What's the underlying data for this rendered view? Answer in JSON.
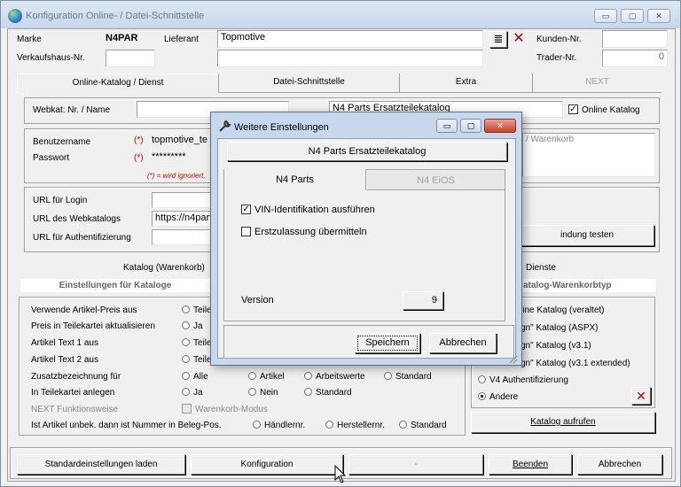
{
  "window": {
    "title": "Konfiguration Online- / Datei-Schnittstelle",
    "caption_buttons": {
      "minimize": "▭",
      "maximize": "▢",
      "close": "✕"
    }
  },
  "header": {
    "marke_label": "Marke",
    "marke_value": "N4PAR",
    "lieferant_label": "Lieferant",
    "lieferant_value": "Topmotive",
    "list_icon": "≣",
    "delete_icon": "✕",
    "kunden_nr_label": "Kunden-Nr.",
    "kunden_nr_value": "",
    "verkaufshaus_label": "Verkaufshaus-Nr.",
    "verkaufshaus_value": "",
    "trader_label": "Trader-Nr.",
    "trader_value": "0"
  },
  "tabs": [
    {
      "label": "Online-Katalog / Dienst"
    },
    {
      "label": "Datei-Schnittstelle"
    },
    {
      "label": "Extra"
    },
    {
      "label": "NEXT"
    }
  ],
  "online": {
    "webkat_label": "Webkat: Nr. / Name",
    "webkat_nr": "",
    "webkat_name": "N4 Parts Ersatzteilekatalog",
    "online_katalog_label": "Online Katalog",
    "benutzer_label": "Benutzername",
    "passwort_label": "Passwort",
    "required_marker": "(*)",
    "benutzer_value": "topmotive_te",
    "passwort_value": "*********",
    "hint": "(*) = wird ignoriert,",
    "warenkorb_hint": "/ Warenkorb",
    "url_login_label": "URL für Login",
    "url_webkatalog_label": "URL des Webkatalogs",
    "url_webkatalog_value": "https://n4part",
    "url_auth_label": "URL für Authentifizierung",
    "verbindung_button": "indung testen"
  },
  "katalog": {
    "section_label": "Katalog (Warenkorb)",
    "settings_title": "Einstellungen für Kataloge",
    "rows": [
      {
        "label": "Verwende Artikel-Preis aus",
        "options": [
          "Teile"
        ]
      },
      {
        "label": "Preis in Teilekartei aktualisieren",
        "options": [
          "Ja"
        ]
      },
      {
        "label": "Artikel Text 1 aus",
        "options": [
          "Teile"
        ]
      },
      {
        "label": "Artikel Text 2 aus",
        "options": [
          "Teile"
        ]
      },
      {
        "label": "Zusatzbezeichnung für",
        "options": [
          "Alle",
          "Artikel",
          "Arbeitswerte",
          "Standard"
        ]
      },
      {
        "label": "In Teilekartei anlegen",
        "options": [
          "Ja",
          "Nein",
          "Standard"
        ]
      }
    ],
    "next_label": "NEXT Funktionsweise",
    "warenkorb_modus": "Warenkorb-Modus",
    "unbek_label": "Ist Artikel unbek. dann ist Nummer in Beleg-Pos.",
    "unbek_options": [
      "Händlernr.",
      "Herstellernr.",
      "Standard"
    ]
  },
  "dienste": {
    "section_label": "Dienste",
    "typ_title": "atalog-Warenkorbtyp",
    "options": [
      "line Katalog (veraltet)",
      "gn\" Katalog (ASPX)",
      "gn\" Katalog (v3.1)",
      "gn\" Katalog (v3.1 extended)",
      "V4 Authentifizierung",
      "Andere"
    ],
    "selected_index": 5,
    "katalog_aufrufen_button": "Katalog aufrufen"
  },
  "footer": {
    "standard_button": "Standardeinstellungen laden",
    "konfiguration_button": "Konfiguration",
    "middle_button": "-",
    "beenden_button": "Beenden",
    "abbrechen_button": "Abbrechen"
  },
  "dialog": {
    "title": "Weitere Einstellungen",
    "header_button": "N4 Parts Ersatzteilekatalog",
    "tabs": [
      {
        "label": "N4 Parts"
      },
      {
        "label": "N4 EiOS"
      }
    ],
    "vin_label": "VIN-Identifikation ausführen",
    "vin_checked": true,
    "erstzulassung_label": "Erstzulassung übermitteln",
    "erstzulassung_checked": false,
    "version_label": "Version",
    "version_value": "9",
    "speichern_button": "Speichern",
    "abbrechen_button": "Abbrechen"
  }
}
